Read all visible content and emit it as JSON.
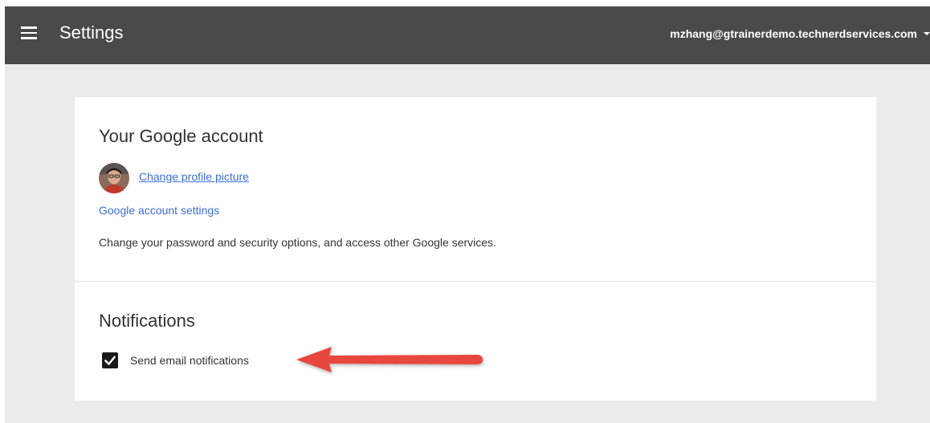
{
  "header": {
    "menu_icon": "hamburger-menu-icon",
    "title": "Settings",
    "account_email": "mzhang@gtrainerdemo.technerdservices.com",
    "account_caret_icon": "caret-down-icon",
    "background_color": "#4a4a4a"
  },
  "account_section": {
    "title": "Your Google account",
    "avatar_icon": "profile-avatar",
    "change_picture_link": "Change profile picture",
    "account_settings_link": "Google account settings",
    "description": "Change your password and security options, and access other Google services."
  },
  "notifications_section": {
    "title": "Notifications",
    "send_email_label": "Send email notifications",
    "send_email_checked": true,
    "checkmark_icon": "checkmark-icon"
  },
  "annotation": {
    "arrow_icon": "red-arrow-icon",
    "arrow_color": "#e8463c"
  },
  "colors": {
    "page_background": "#ebebeb",
    "card_background": "#ffffff",
    "link": "#3b6ed8"
  }
}
